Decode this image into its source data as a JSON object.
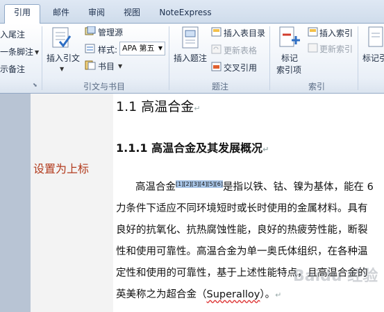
{
  "tabs": [
    {
      "label": "引用",
      "active": true
    },
    {
      "label": "邮件",
      "active": false
    },
    {
      "label": "审阅",
      "active": false
    },
    {
      "label": "视图",
      "active": false
    },
    {
      "label": "NoteExpress",
      "active": false
    }
  ],
  "ribbon": {
    "footnotes": {
      "insert_endnote": "入尾注",
      "next_footnote": "一条脚注",
      "show_notes": "示备注"
    },
    "citations": {
      "insert_citation": "插入引文",
      "manage_sources": "管理源",
      "style_label": "样式:",
      "style_value": "APA 第五",
      "bibliography": "书目",
      "group_label": "引文与书目"
    },
    "captions": {
      "insert_caption": "插入题注",
      "insert_table_of_figures": "插入表目录",
      "update_table": "更新表格",
      "cross_reference": "交叉引用",
      "group_label": "题注"
    },
    "index": {
      "mark_entry_line1": "标记",
      "mark_entry_line2": "索引项",
      "insert_index": "插入索引",
      "update_index": "更新索引",
      "group_label": "索引"
    },
    "toa": {
      "mark_citation": "标记引"
    }
  },
  "document": {
    "heading1": "1.1  高温合金",
    "heading2": "1.1.1 高温合金及其发展概况",
    "margin_note": "设置为上标",
    "para_line1_before": "高温合金",
    "para_line1_cite": "[1][2][3][4][5][6]",
    "para_line1_after": "是指以铁、钴、镍为基体，能在 6",
    "para_line2": "力条件下适应不同环境短时或长时使用的金属材料。具有",
    "para_line3": "良好的抗氧化、抗热腐蚀性能，良好的热疲劳性能，断裂",
    "para_line4": "性和使用可靠性。高温合金为单一奥氏体组织，在各种温",
    "para_line5": "定性和使用的可靠性，基于上述性能特点，且高温合金的",
    "para_line6_before": "英美称之为超合金（",
    "para_line6_word": "Superalloy",
    "para_line6_after": "）。",
    "paragraph_mark": "↵"
  },
  "watermark": "Baidu 经验",
  "colors": {
    "margin_note": "#b23a1c",
    "citation_highlight": "#a9c6e8",
    "ribbon_border": "#8ea7c6"
  }
}
